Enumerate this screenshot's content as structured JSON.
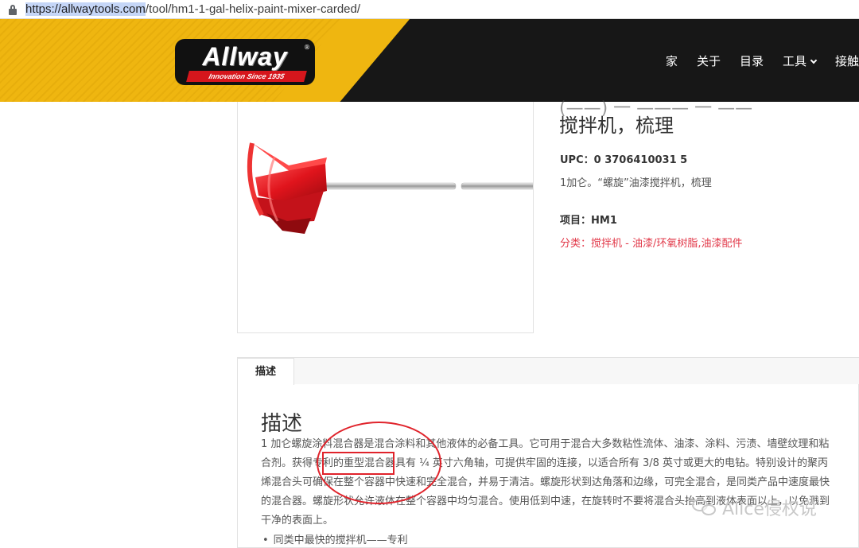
{
  "browser": {
    "url_host_selected": "https://allwaytools.com",
    "url_path": "/tool/hm1-1-gal-helix-paint-mixer-carded/"
  },
  "brand": {
    "logo_text": "Allway",
    "logo_tagline": "Innovation Since 1935",
    "colors": {
      "yellow": "#efb610",
      "dark": "#171717",
      "red": "#d6161c"
    }
  },
  "nav": {
    "items": [
      "家",
      "关于",
      "目录",
      "工具",
      "接触"
    ]
  },
  "product": {
    "title_line2": "搅拌机，梳理",
    "upc": "UPC：0 3706410031 5",
    "short_desc": "1加仑。“螺旋”油漆搅拌机，梳理",
    "item": "项目：HM1",
    "category_label": "分类：",
    "categories": "搅拌机 - 油漆/环氧树脂,油漆配件"
  },
  "tabs": {
    "active": "描述"
  },
  "description": {
    "heading": "描述",
    "paragraph": "1 加仑螺旋涂料混合器是混合涂料和其他液体的必备工具。它可用于混合大多数粘性流体、油漆、涂料、污渍、墙壁纹理和粘合剂。获得专利的重型混合器具有 ¼ 英寸六角轴，可提供牢固的连接，以适合所有 3/8 英寸或更大的电钻。特别设计的聚丙烯混合头可确保在整个容器中快速和完全混合，并易于清洁。螺旋形状到达角落和边缘，可完全混合，是同类产品中速度最快的混合器。螺旋形状允许液体在整个容器中均匀混合。使用低到中速，在旋转时不要将混合头抬高到液体表面以上，以免溅到干净的表面上。",
    "bullet": "同类中最快的搅拌机——专利"
  },
  "watermark": {
    "text": "Alice侵权说"
  }
}
